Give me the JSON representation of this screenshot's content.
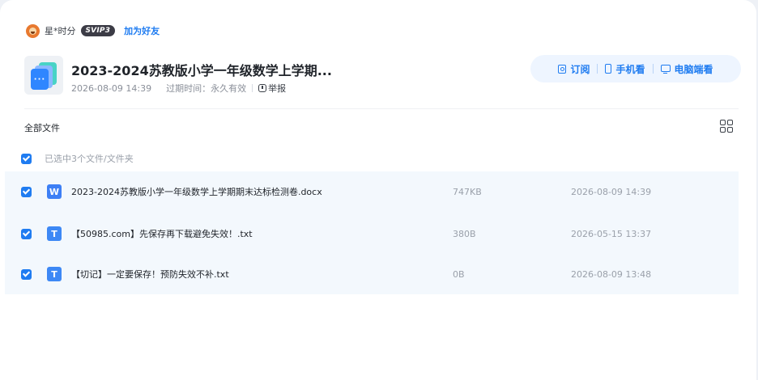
{
  "user": {
    "name": "星*时分",
    "vip_badge": "SVIP3",
    "add_friend": "加为好友"
  },
  "share": {
    "thumb_glyph": "···",
    "title": "2023-2024苏教版小学一年级数学上学期...",
    "created": "2026-08-09 14:39",
    "expire": "过期时间：永久有效",
    "report": "举报"
  },
  "actions": {
    "subscribe": "订阅",
    "phone": "手机看",
    "pc": "电脑端看"
  },
  "list": {
    "all_files": "全部文件",
    "selected_text": "已选中3个文件/文件夹",
    "files": [
      {
        "type": "W",
        "name": "2023-2024苏教版小学一年级数学上学期期末达标检测卷.docx",
        "size": "747KB",
        "date": "2026-08-09 14:39"
      },
      {
        "type": "T",
        "name": "【50985.com】先保存再下载避免失效！.txt",
        "size": "380B",
        "date": "2026-05-15 13:37"
      },
      {
        "type": "T",
        "name": "【切记】一定要保存！预防失效不补.txt",
        "size": "0B",
        "date": "2026-08-09 13:48"
      }
    ]
  },
  "colors": {
    "accent": "#1f7cf1",
    "row_bg": "#f3f8fd",
    "vip_badge_bg": "#3c3c46"
  },
  "icons": {
    "avatar": "avatar",
    "report": "report-icon",
    "subscribe": "subscribe-icon",
    "phone": "phone-icon",
    "pc": "monitor-icon",
    "view": "grid-view-icon",
    "doc": "word-doc-icon",
    "txt": "text-file-icon"
  }
}
